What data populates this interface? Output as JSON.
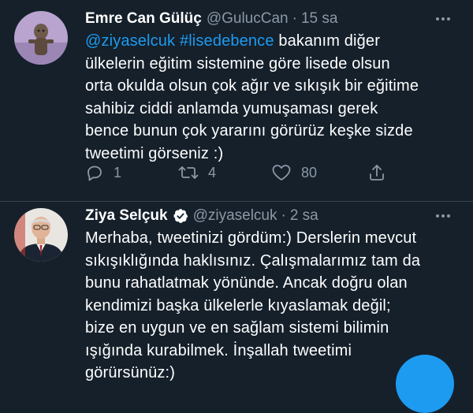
{
  "tweets": [
    {
      "author_name": "Emre Can Gülüç",
      "handle": "@GulucCan",
      "separator": "·",
      "time": "15 sa",
      "verified": false,
      "lines": [
        [
          {
            "text": "@ziyaselcuk",
            "kind": "mention"
          },
          {
            "text": " ",
            "kind": "text"
          },
          {
            "text": "#lisedebence",
            "kind": "hashtag"
          },
          {
            "text": " bakanım diğer",
            "kind": "text"
          }
        ],
        [
          {
            "text": "ülkelerin eğitim sistemine göre lisede olsun",
            "kind": "text"
          }
        ],
        [
          {
            "text": "orta okulda olsun çok ağır ve sıkışık bir eğitime",
            "kind": "text"
          }
        ],
        [
          {
            "text": "sahibiz ciddi anlamda yumuşaması gerek",
            "kind": "text"
          }
        ],
        [
          {
            "text": "bence bunun çok yararını görürüz keşke sizde",
            "kind": "text"
          }
        ],
        [
          {
            "text": "tweetimi görseniz :)",
            "kind": "text"
          }
        ]
      ],
      "actions": {
        "reply_count": "1",
        "retweet_count": "4",
        "like_count": "80"
      }
    },
    {
      "author_name": "Ziya Selçuk",
      "handle": "@ziyaselcuk",
      "separator": "·",
      "time": "2 sa",
      "verified": true,
      "lines": [
        [
          {
            "text": "Merhaba, tweetinizi gördüm:) Derslerin mevcut",
            "kind": "text"
          }
        ],
        [
          {
            "text": "sıkışıklığında haklısınız. Çalışmalarımız tam da",
            "kind": "text"
          }
        ],
        [
          {
            "text": "bunu rahatlatmak yönünde. Ancak doğru olan",
            "kind": "text"
          }
        ],
        [
          {
            "text": "kendimizi başka ülkelerle kıyaslamak değil;",
            "kind": "text"
          }
        ],
        [
          {
            "text": "bize en uygun ve en sağlam sistemi bilimin",
            "kind": "text"
          }
        ],
        [
          {
            "text": "ışığında kurabilmek. İnşallah tweetimi",
            "kind": "text"
          }
        ],
        [
          {
            "text": "görürsünüz:)",
            "kind": "text"
          }
        ]
      ]
    }
  ],
  "icons": {
    "reply": "reply-icon",
    "retweet": "retweet-icon",
    "like": "heart-icon",
    "share": "share-icon",
    "more": "more-options-icon",
    "verified": "verified-badge-icon",
    "compose": "compose-fab"
  },
  "colors": {
    "background": "#15202b",
    "text": "#ffffff",
    "secondary_text": "#8b98a5",
    "link": "#1d9bf0",
    "divider": "#38444d",
    "accent": "#1d9bf0"
  }
}
